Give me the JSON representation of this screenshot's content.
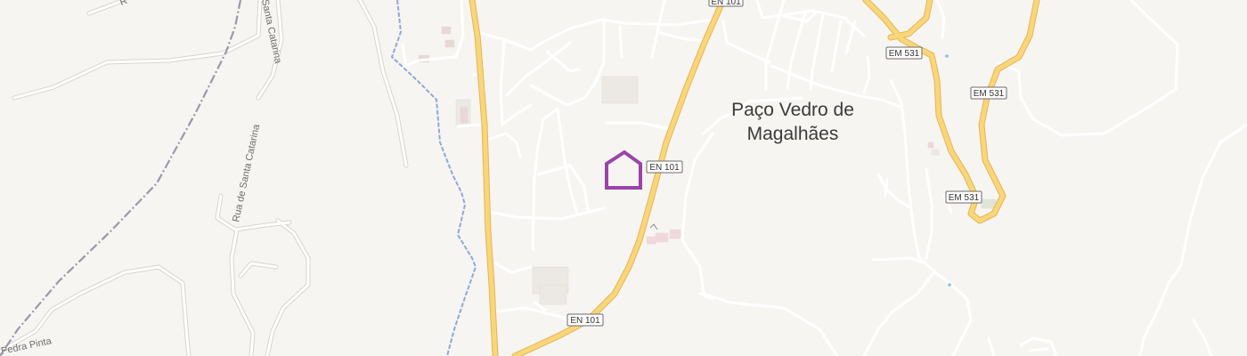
{
  "colors": {
    "background": "#f7f5f2",
    "minor_road": "#ffffff",
    "major_road": "#f9d67a",
    "major_road_casing": "#e3b655",
    "river": "#8fa9d6",
    "rail": "#9c98a8",
    "marker": "#9b44a8"
  },
  "place_label": {
    "line1": "Paço Vedro de",
    "line2": "Magalhães"
  },
  "route_shields": {
    "en101_top": "EN 101",
    "en101_mid": "EN 101",
    "en101_bottom": "EN 101",
    "em531_1": "EM 531",
    "em531_2": "EM 531",
    "em531_3": "EM 531"
  },
  "street_labels": {
    "santa_catarina": "Rua de Santa Catarina",
    "santa_catarina_top": "Santa Catarina",
    "pedra_pinta": "Pedra Pinta",
    "r_fragment": "R"
  },
  "marker": {
    "icon": "home-icon"
  }
}
